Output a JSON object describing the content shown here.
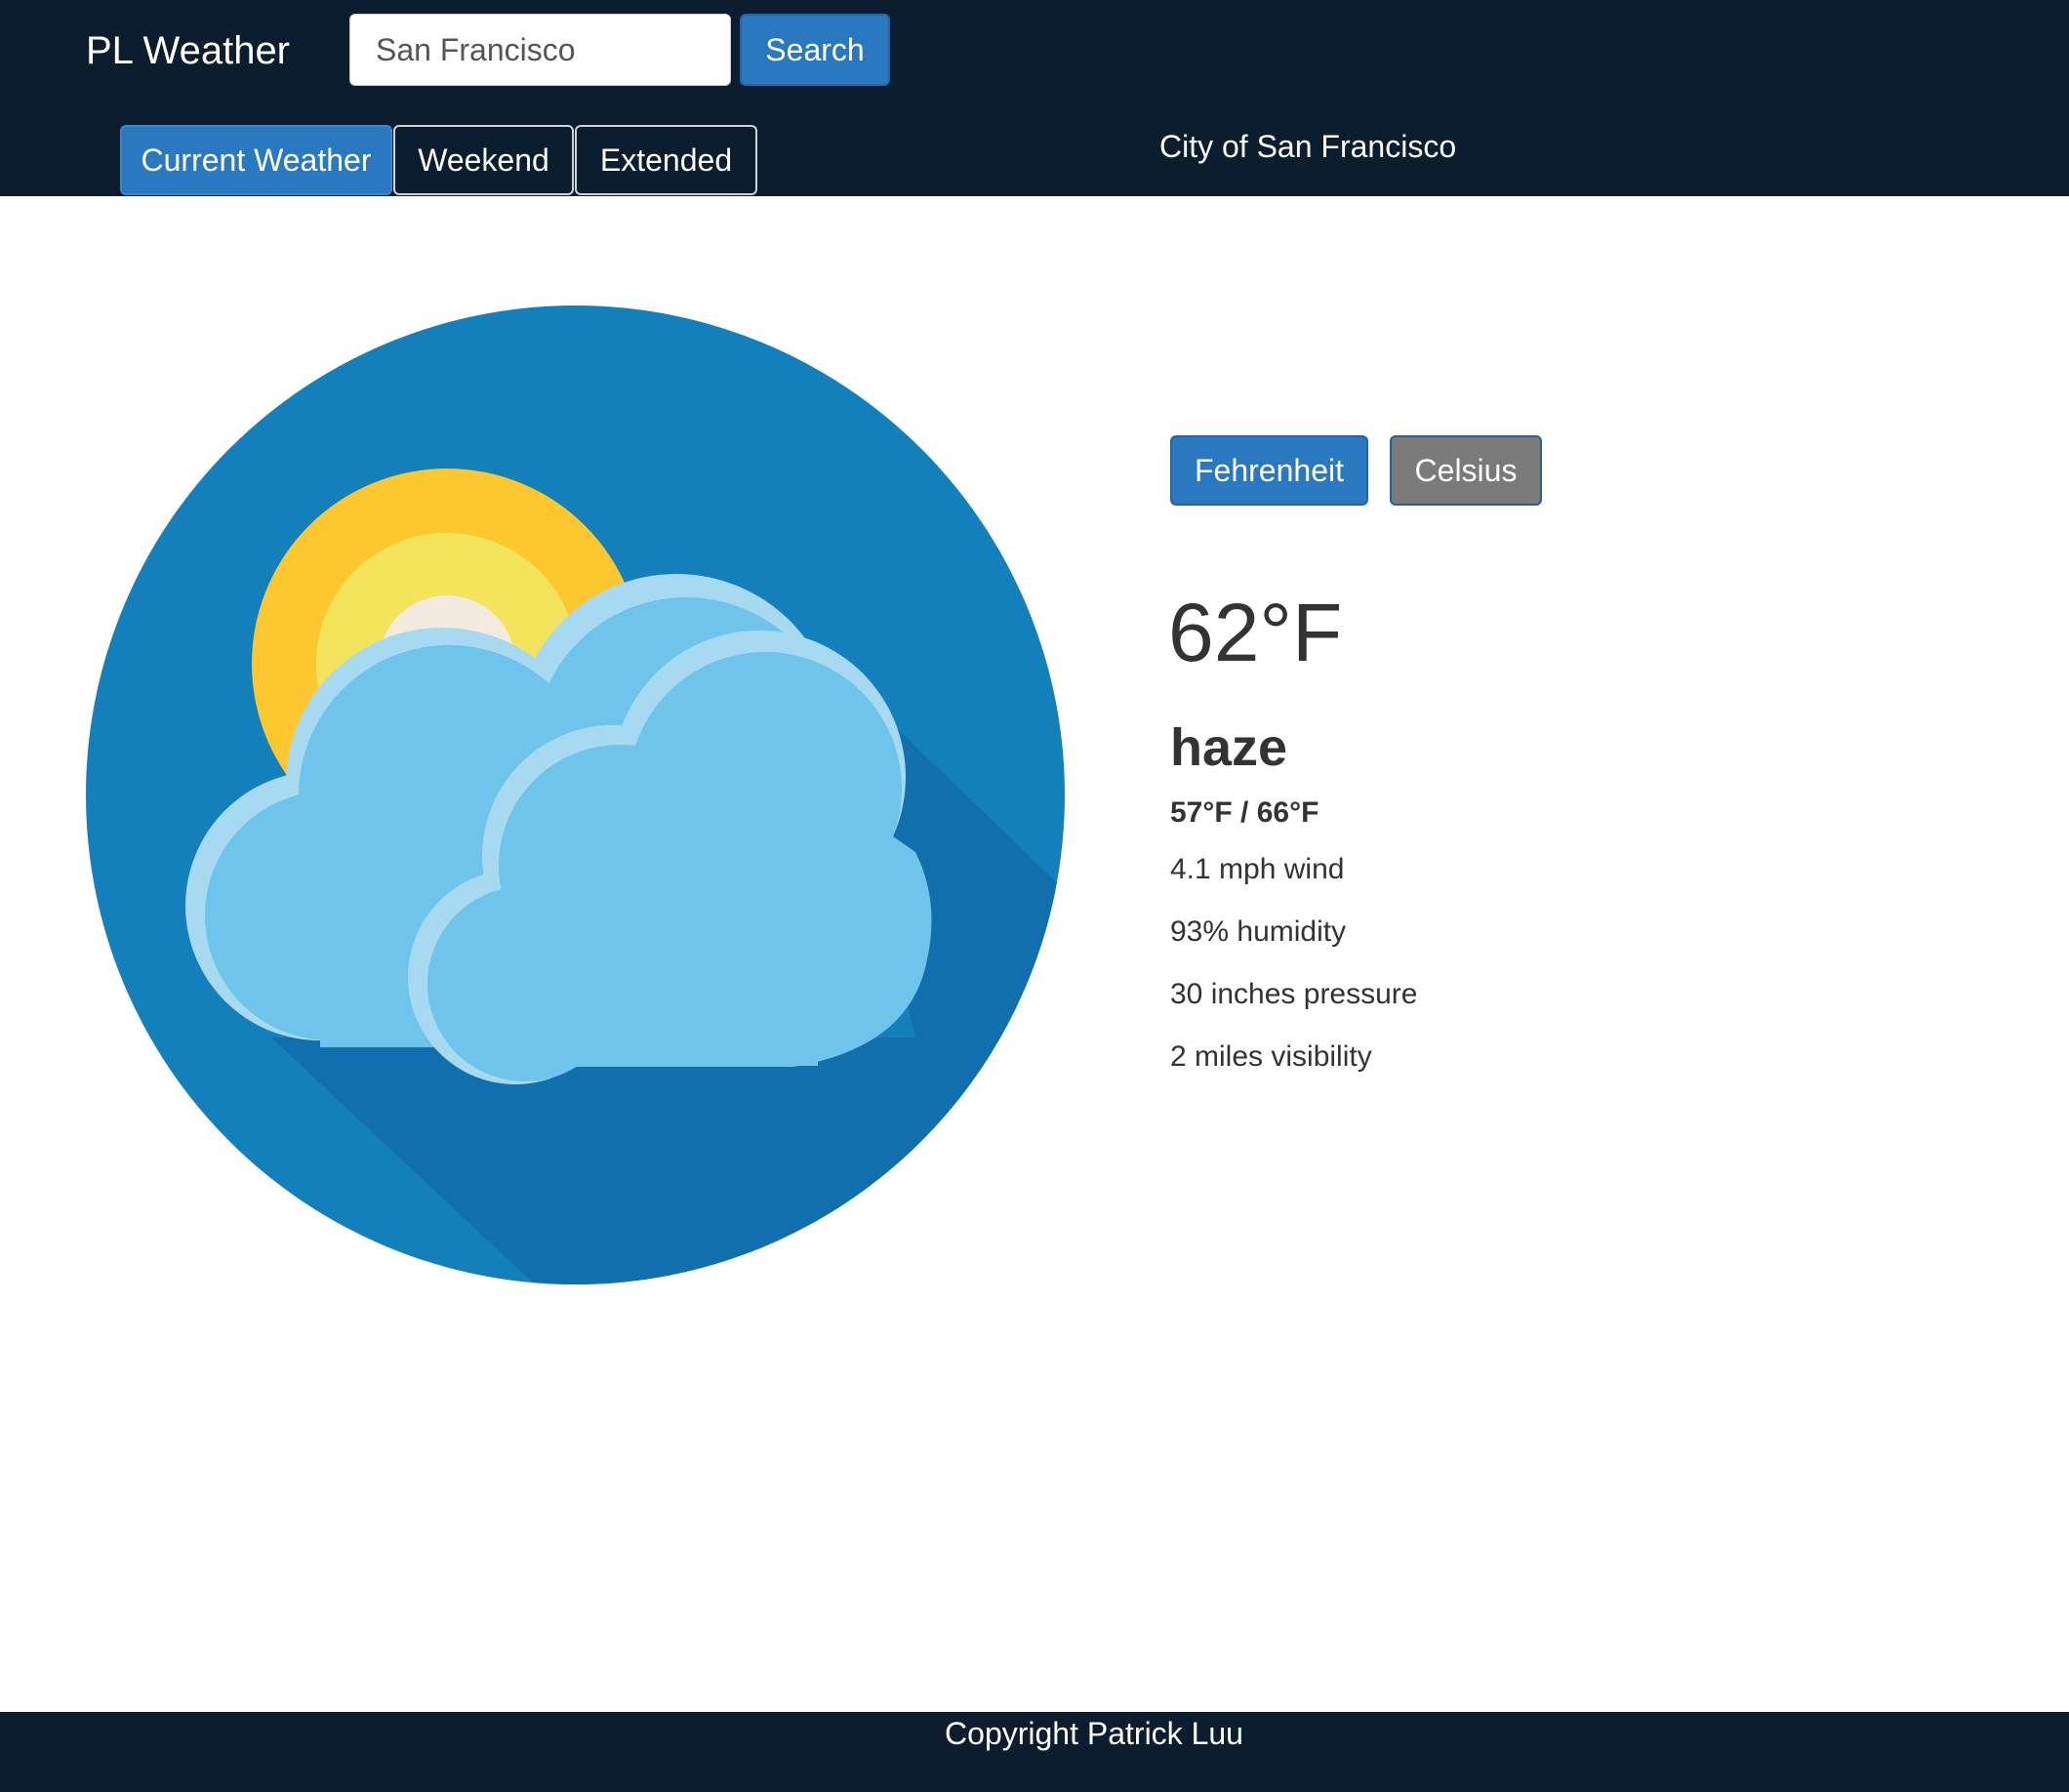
{
  "header": {
    "brand": "PL Weather",
    "search": {
      "value": "San Francisco",
      "button_label": "Search"
    },
    "tabs": [
      {
        "label": "Current Weather",
        "active": true
      },
      {
        "label": "Weekend",
        "active": false
      },
      {
        "label": "Extended",
        "active": false
      }
    ],
    "city_title": "City of San Francisco"
  },
  "illustration": {
    "icon": "sun-behind-clouds-icon"
  },
  "units": {
    "fahrenheit_label": "Fehrenheit",
    "celsius_label": "Celsius",
    "selected": "fahrenheit"
  },
  "current": {
    "temperature": "62°F",
    "condition": "haze",
    "hi_lo": "57°F / 66°F",
    "wind": "4.1 mph wind",
    "humidity": "93% humidity",
    "pressure": "30 inches pressure",
    "visibility": "2 miles visibility"
  },
  "footer": {
    "copyright": "Copyright Patrick Luu"
  },
  "colors": {
    "navbar": "#0b1d2e",
    "primary": "#2a78c0",
    "secondary_button": "#7a7a7a",
    "sky_circle": "#137fbb",
    "cloud": "#6fc4ec",
    "sun_outer": "#fdc82f"
  }
}
